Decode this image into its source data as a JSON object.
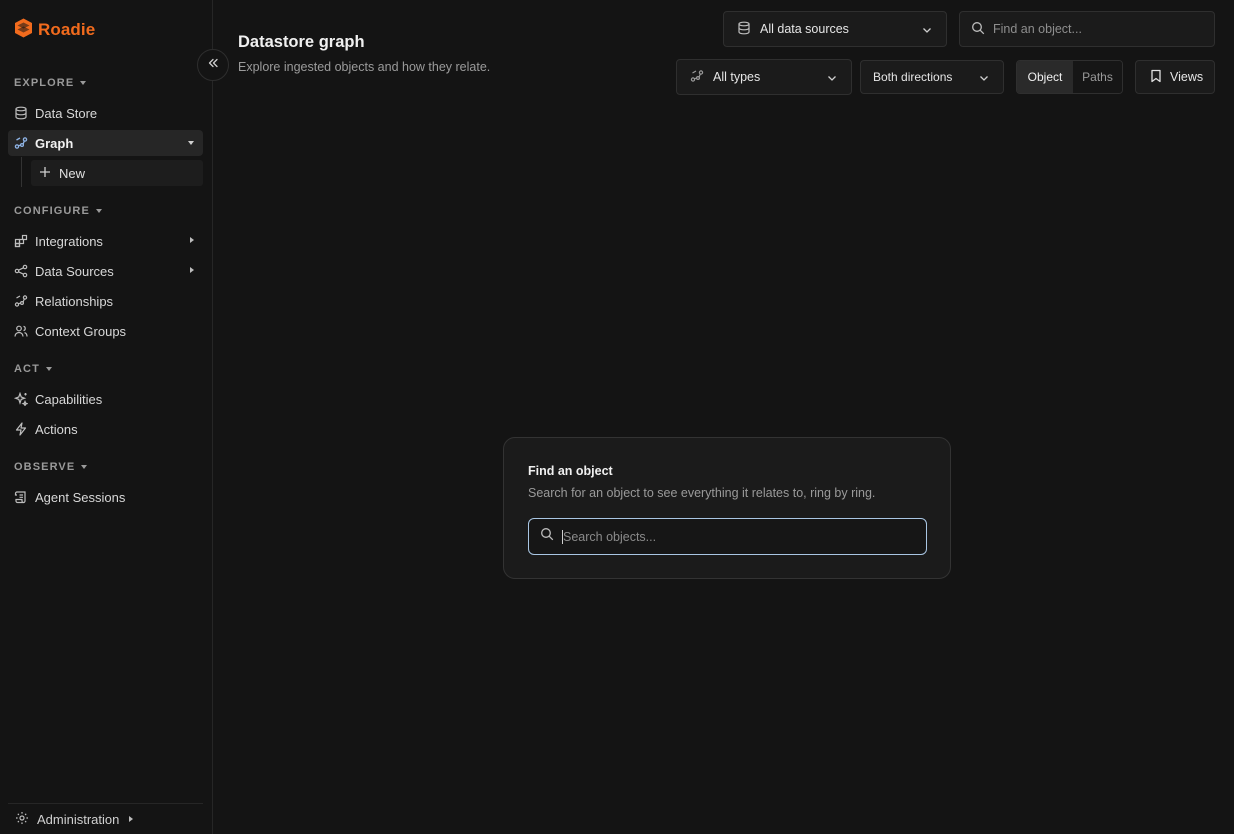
{
  "brand": {
    "name": "Roadie",
    "color": "#f26b1d"
  },
  "sidebar": {
    "sections": {
      "explore": "EXPLORE",
      "configure": "CONFIGURE",
      "act": "ACT",
      "observe": "OBSERVE"
    },
    "items": {
      "data_store": "Data Store",
      "graph": "Graph",
      "new": "New",
      "integrations": "Integrations",
      "data_sources": "Data Sources",
      "relationships": "Relationships",
      "context_groups": "Context Groups",
      "capabilities": "Capabilities",
      "actions": "Actions",
      "agent_sessions": "Agent Sessions"
    },
    "footer": "Administration"
  },
  "header": {
    "title": "Datastore graph",
    "subtitle": "Explore ingested objects and how they relate."
  },
  "toolbar": {
    "data_source_select": "All data sources",
    "find_placeholder": "Find an object...",
    "types_select": "All types",
    "direction_select": "Both directions",
    "mode_object": "Object",
    "mode_paths": "Paths",
    "views": "Views"
  },
  "card": {
    "title": "Find an object",
    "description": "Search for an object to see everything it relates to, ring by ring.",
    "search_placeholder": "Search objects..."
  },
  "colors": {
    "background": "#141414",
    "accent": "#f26b1d",
    "focus_border": "#a9c6e3"
  }
}
